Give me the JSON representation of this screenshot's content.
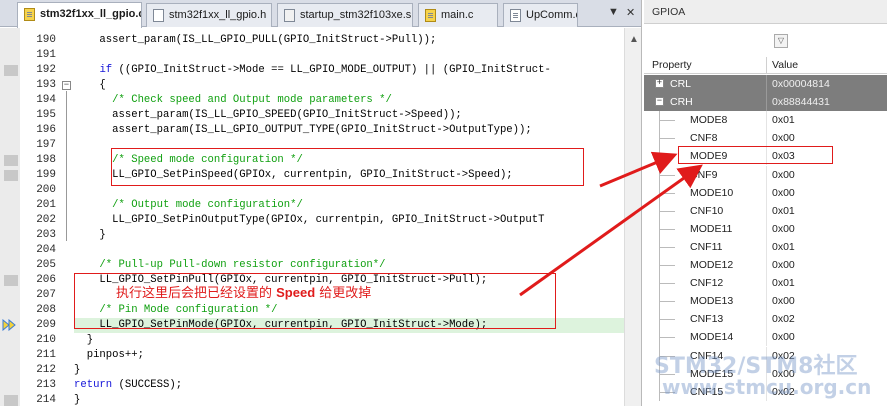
{
  "editor": {
    "tabs": [
      {
        "label": "stm32f1xx_ll_gpio.c",
        "icon": "c-file-icon",
        "active": true
      },
      {
        "label": "stm32f1xx_ll_gpio.h",
        "icon": "header-file-icon",
        "active": false
      },
      {
        "label": "startup_stm32f103xe.s",
        "icon": "asm-file-icon",
        "active": false
      },
      {
        "label": "main.c",
        "icon": "c-file-icon",
        "active": false
      },
      {
        "label": "UpComm.c",
        "icon": "c-file-icon",
        "active": false
      }
    ],
    "tab_menu_glyph": "▼",
    "tab_close_glyph": "✕",
    "current_line": "209",
    "lines": [
      {
        "num": "190",
        "text": "    assert_param(IS_LL_GPIO_PULL(GPIO_InitStruct->Pull));"
      },
      {
        "num": "191",
        "text": ""
      },
      {
        "num": "192",
        "text": "    if ((GPIO_InitStruct->Mode == LL_GPIO_MODE_OUTPUT) || (GPIO_InitStruct-"
      },
      {
        "num": "193",
        "text": "    {"
      },
      {
        "num": "194",
        "text": "      /* Check speed and Output mode parameters */"
      },
      {
        "num": "195",
        "text": "      assert_param(IS_LL_GPIO_SPEED(GPIO_InitStruct->Speed));"
      },
      {
        "num": "196",
        "text": "      assert_param(IS_LL_GPIO_OUTPUT_TYPE(GPIO_InitStruct->OutputType));"
      },
      {
        "num": "197",
        "text": ""
      },
      {
        "num": "198",
        "text": "      /* Speed mode configuration */"
      },
      {
        "num": "199",
        "text": "      LL_GPIO_SetPinSpeed(GPIOx, currentpin, GPIO_InitStruct->Speed);"
      },
      {
        "num": "200",
        "text": ""
      },
      {
        "num": "201",
        "text": "      /* Output mode configuration*/"
      },
      {
        "num": "202",
        "text": "      LL_GPIO_SetPinOutputType(GPIOx, currentpin, GPIO_InitStruct->OutputT"
      },
      {
        "num": "203",
        "text": "    }"
      },
      {
        "num": "204",
        "text": ""
      },
      {
        "num": "205",
        "text": "    /* Pull-up Pull-down resistor configuration*/"
      },
      {
        "num": "206",
        "text": "    LL_GPIO_SetPinPull(GPIOx, currentpin, GPIO_InitStruct->Pull);"
      },
      {
        "num": "207",
        "text": ""
      },
      {
        "num": "208",
        "text": "    /* Pin Mode configuration */"
      },
      {
        "num": "209",
        "text": "    LL_GPIO_SetPinMode(GPIOx, currentpin, GPIO_InitStruct->Mode);"
      },
      {
        "num": "210",
        "text": "  }"
      },
      {
        "num": "211",
        "text": "  pinpos++;"
      },
      {
        "num": "212",
        "text": "}"
      },
      {
        "num": "213",
        "text": "return (SUCCESS);"
      },
      {
        "num": "214",
        "text": "}"
      }
    ]
  },
  "annotation": {
    "text_before": "执行这里后会把已经设置的 ",
    "text_bold": "Speed",
    "text_after": " 给更改掉",
    "color": "#e01b1b"
  },
  "peripheral": {
    "title": "GPIOA",
    "dropdown_glyph": "▽",
    "columns": {
      "property": "Property",
      "value": "Value"
    },
    "registers": [
      {
        "name": "CRL",
        "value": "0x00004814",
        "expanded": false
      },
      {
        "name": "CRH",
        "value": "0x88844431",
        "expanded": true
      }
    ],
    "fields": [
      {
        "name": "MODE8",
        "value": "0x01"
      },
      {
        "name": "CNF8",
        "value": "0x00"
      },
      {
        "name": "MODE9",
        "value": "0x03"
      },
      {
        "name": "CNF9",
        "value": "0x00"
      },
      {
        "name": "MODE10",
        "value": "0x00"
      },
      {
        "name": "CNF10",
        "value": "0x01"
      },
      {
        "name": "MODE11",
        "value": "0x00"
      },
      {
        "name": "CNF11",
        "value": "0x01"
      },
      {
        "name": "MODE12",
        "value": "0x00"
      },
      {
        "name": "CNF12",
        "value": "0x01"
      },
      {
        "name": "MODE13",
        "value": "0x00"
      },
      {
        "name": "CNF13",
        "value": "0x02"
      },
      {
        "name": "MODE14",
        "value": "0x00"
      },
      {
        "name": "CNF14",
        "value": "0x02"
      },
      {
        "name": "MODE15",
        "value": "0x00"
      },
      {
        "name": "CNF15",
        "value": "0x02"
      }
    ],
    "expand_glyph": "+",
    "collapse_glyph": "−"
  },
  "watermark": {
    "line1": "STM32/STM8社区",
    "line2": "www.stmcu.org.cn"
  },
  "colors": {
    "accent_red": "#e01b1b",
    "comment_green": "#10a010",
    "keyword_blue": "#1414d8",
    "current_line_bg": "#ddf3dd",
    "register_row_bg": "#7d7d7d"
  }
}
